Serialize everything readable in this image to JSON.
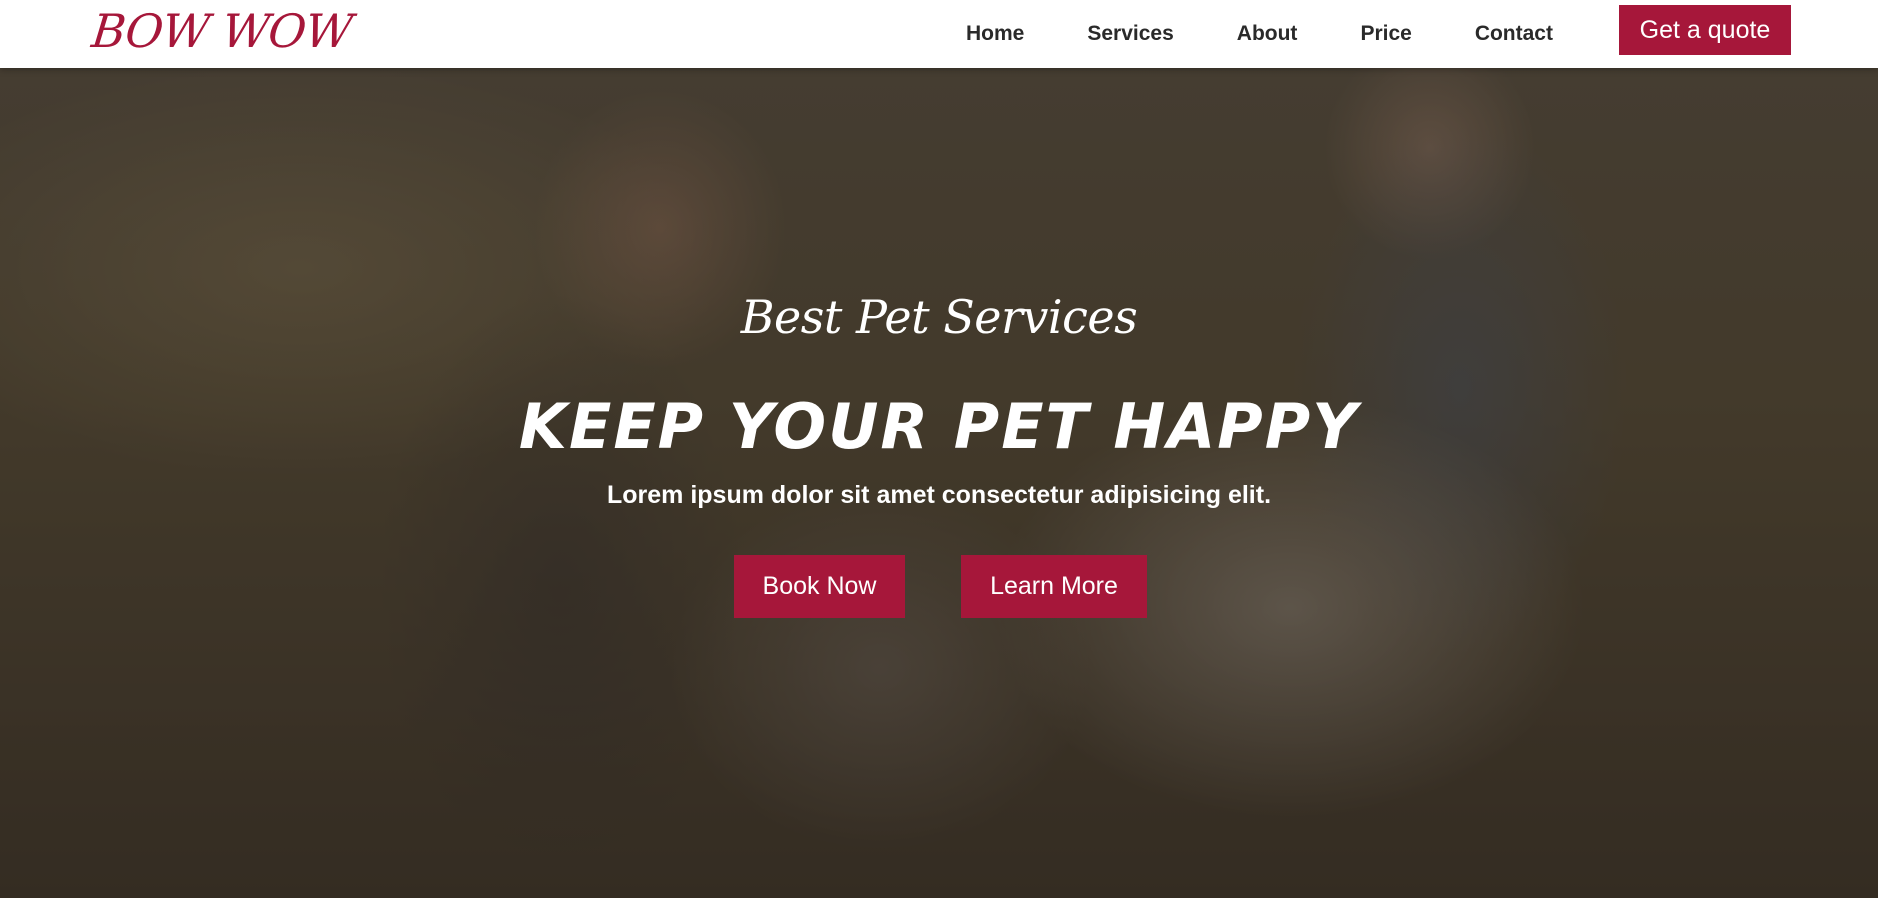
{
  "brand": {
    "logo_text": "BOW WOW",
    "accent_color": "#a6173a"
  },
  "nav": {
    "links": [
      {
        "label": "Home"
      },
      {
        "label": "Services"
      },
      {
        "label": "About"
      },
      {
        "label": "Price"
      },
      {
        "label": "Contact"
      }
    ],
    "cta_label": "Get a quote"
  },
  "hero": {
    "kicker": "Best Pet Services",
    "title": "KEEP YOUR PET HAPPY",
    "subtitle": "Lorem ipsum dolor sit amet consectetur adipisicing elit.",
    "primary_button": "Book Now",
    "secondary_button": "Learn More"
  }
}
